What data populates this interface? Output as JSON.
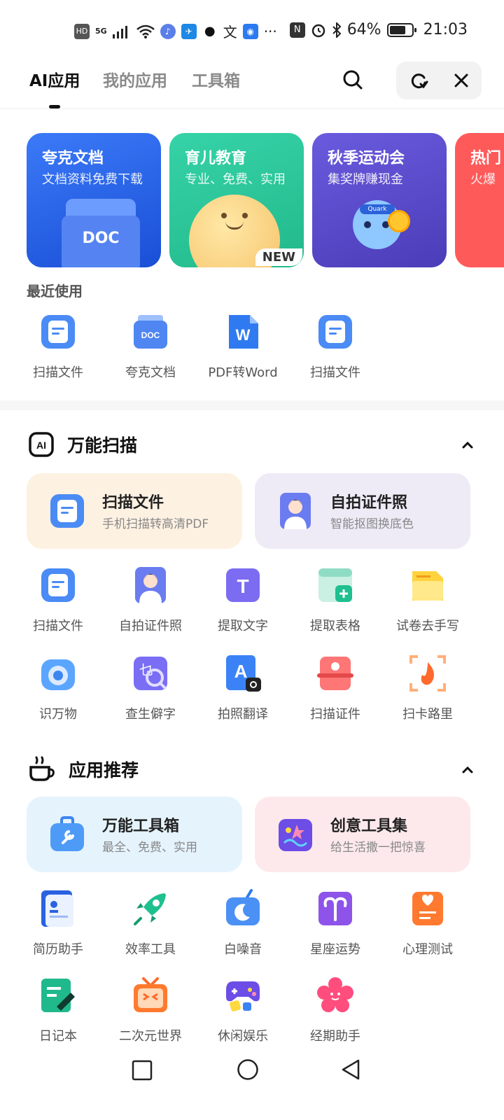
{
  "status": {
    "left_glyphs": [
      "HD",
      "5G"
    ],
    "more": "···",
    "battery": "64%",
    "time": "21:03"
  },
  "tabs": [
    {
      "label": "AI应用",
      "active": true
    },
    {
      "label": "我的应用",
      "active": false
    },
    {
      "label": "工具箱",
      "active": false
    }
  ],
  "banners": [
    {
      "title": "夸克文档",
      "subtitle": "文档资料免费下载",
      "art_text": "DOC",
      "color": "#2f6cf5"
    },
    {
      "title": "育儿教育",
      "subtitle": "专业、免费、实用",
      "badge": "NEW",
      "color": "#2fcf9a"
    },
    {
      "title": "秋季运动会",
      "subtitle": "集奖牌赚现金",
      "art_text": "Quark",
      "color": "#5d4ed0"
    },
    {
      "title": "热门",
      "subtitle": "火爆",
      "color": "#ff5a5a"
    }
  ],
  "recent": {
    "title": "最近使用",
    "items": [
      {
        "label": "扫描文件",
        "icon": "scan-doc-icon"
      },
      {
        "label": "夸克文档",
        "icon": "doc-icon"
      },
      {
        "label": "PDF转Word",
        "icon": "word-icon"
      },
      {
        "label": "扫描文件",
        "icon": "scan-doc-icon"
      }
    ]
  },
  "scan_section": {
    "title": "万能扫描",
    "badge": "AI",
    "cards": [
      {
        "title": "扫描文件",
        "subtitle": "手机扫描转高清PDF",
        "bg": "#fdf1e2"
      },
      {
        "title": "自拍证件照",
        "subtitle": "智能抠图换底色",
        "bg": "#eeebf7"
      }
    ],
    "items": [
      {
        "label": "扫描文件",
        "icon": "scan-doc-icon"
      },
      {
        "label": "自拍证件照",
        "icon": "id-photo-icon"
      },
      {
        "label": "提取文字",
        "icon": "text-extract-icon",
        "glyph": "T"
      },
      {
        "label": "提取表格",
        "icon": "table-extract-icon"
      },
      {
        "label": "试卷去手写",
        "icon": "exam-paper-icon"
      },
      {
        "label": "识万物",
        "icon": "camera-lens-icon"
      },
      {
        "label": "查生僻字",
        "icon": "rare-char-search-icon",
        "glyph": "乜"
      },
      {
        "label": "拍照翻译",
        "icon": "photo-translate-icon",
        "glyph": "A"
      },
      {
        "label": "扫描证件",
        "icon": "id-card-scan-icon"
      },
      {
        "label": "扫卡路里",
        "icon": "calorie-flame-icon"
      }
    ]
  },
  "apps_section": {
    "title": "应用推荐",
    "cards": [
      {
        "title": "万能工具箱",
        "subtitle": "最全、免费、实用",
        "bg": "#e5f3fd"
      },
      {
        "title": "创意工具集",
        "subtitle": "给生活撒一把惊喜",
        "bg": "#fde9ec"
      }
    ],
    "items": [
      {
        "label": "简历助手",
        "icon": "resume-icon"
      },
      {
        "label": "效率工具",
        "icon": "rocket-icon"
      },
      {
        "label": "白噪音",
        "icon": "white-noise-moon-icon"
      },
      {
        "label": "星座运势",
        "icon": "zodiac-aries-icon"
      },
      {
        "label": "心理测试",
        "icon": "psych-test-icon"
      },
      {
        "label": "日记本",
        "icon": "diary-icon"
      },
      {
        "label": "二次元世界",
        "icon": "anime-tv-icon"
      },
      {
        "label": "休闲娱乐",
        "icon": "gamepad-icon"
      },
      {
        "label": "经期助手",
        "icon": "period-flower-icon"
      }
    ]
  }
}
